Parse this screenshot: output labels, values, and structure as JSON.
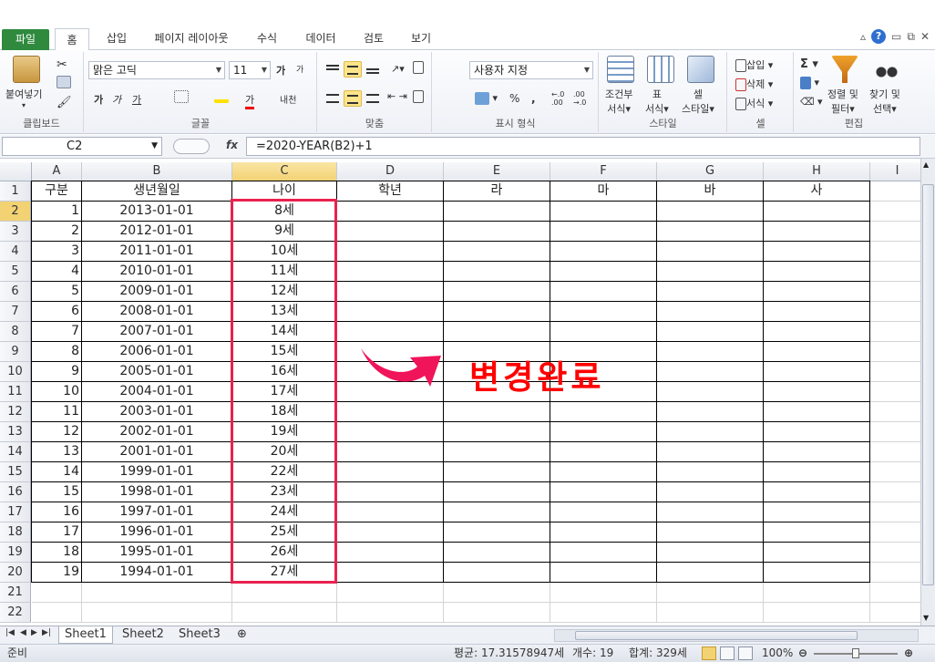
{
  "ribbon": {
    "tabs": [
      "파일",
      "홈",
      "삽입",
      "페이지 레이아웃",
      "수식",
      "데이터",
      "검토",
      "보기"
    ],
    "clipboard": {
      "paste": "붙여넣기",
      "label": "클립보드"
    },
    "font": {
      "name": "맑은 고딕",
      "size": "11",
      "label": "글꼴",
      "bold": "가",
      "italic": "가",
      "underline": "가",
      "grow": "가",
      "shrink": "가",
      "phonetic": "내천",
      "fontcolor": "가"
    },
    "alignment": {
      "label": "맞춤"
    },
    "number": {
      "format": "사용자 지정",
      "label": "표시 형식",
      "percent": "%",
      "comma": ","
    },
    "styles": {
      "conditional": [
        "조건부",
        "서식"
      ],
      "table": [
        "표",
        "서식"
      ],
      "cell": [
        "셀",
        "스타일"
      ],
      "label": "스타일"
    },
    "cells": {
      "insert": "삽입",
      "delete": "삭제",
      "format": "서식",
      "label": "셀"
    },
    "editing": {
      "sum": "Σ",
      "sort": [
        "정렬 및",
        "필터"
      ],
      "find": [
        "찾기 및",
        "선택"
      ],
      "label": "편집"
    }
  },
  "formula_bar": {
    "name_box": "C2",
    "fx": "fx",
    "formula": "=2020-YEAR(B2)+1"
  },
  "columns": [
    "A",
    "B",
    "C",
    "D",
    "E",
    "F",
    "G",
    "H",
    "I"
  ],
  "header_row": [
    "구분",
    "생년월일",
    "나이",
    "학년",
    "라",
    "마",
    "바",
    "사"
  ],
  "rows": [
    [
      "1",
      "2013-01-01",
      "8세"
    ],
    [
      "2",
      "2012-01-01",
      "9세"
    ],
    [
      "3",
      "2011-01-01",
      "10세"
    ],
    [
      "4",
      "2010-01-01",
      "11세"
    ],
    [
      "5",
      "2009-01-01",
      "12세"
    ],
    [
      "6",
      "2008-01-01",
      "13세"
    ],
    [
      "7",
      "2007-01-01",
      "14세"
    ],
    [
      "8",
      "2006-01-01",
      "15세"
    ],
    [
      "9",
      "2005-01-01",
      "16세"
    ],
    [
      "10",
      "2004-01-01",
      "17세"
    ],
    [
      "11",
      "2003-01-01",
      "18세"
    ],
    [
      "12",
      "2002-01-01",
      "19세"
    ],
    [
      "13",
      "2001-01-01",
      "20세"
    ],
    [
      "14",
      "1999-01-01",
      "22세"
    ],
    [
      "15",
      "1998-01-01",
      "23세"
    ],
    [
      "16",
      "1997-01-01",
      "24세"
    ],
    [
      "17",
      "1996-01-01",
      "25세"
    ],
    [
      "18",
      "1995-01-01",
      "26세"
    ],
    [
      "19",
      "1994-01-01",
      "27세"
    ]
  ],
  "row_numbers": [
    "1",
    "2",
    "3",
    "4",
    "5",
    "6",
    "7",
    "8",
    "9",
    "10",
    "11",
    "12",
    "13",
    "14",
    "15",
    "16",
    "17",
    "18",
    "19",
    "20",
    "21",
    "22"
  ],
  "annotation": "변경완료",
  "sheets": [
    "Sheet1",
    "Sheet2",
    "Sheet3"
  ],
  "status": {
    "ready": "준비",
    "average": "평균: 17.31578947세",
    "count": "개수: 19",
    "sum": "합계: 329세",
    "zoom": "100%"
  },
  "colors": {
    "highlight": "#e8224f",
    "annotation": "#ff0000",
    "file_tab": "#2f8a3e"
  }
}
